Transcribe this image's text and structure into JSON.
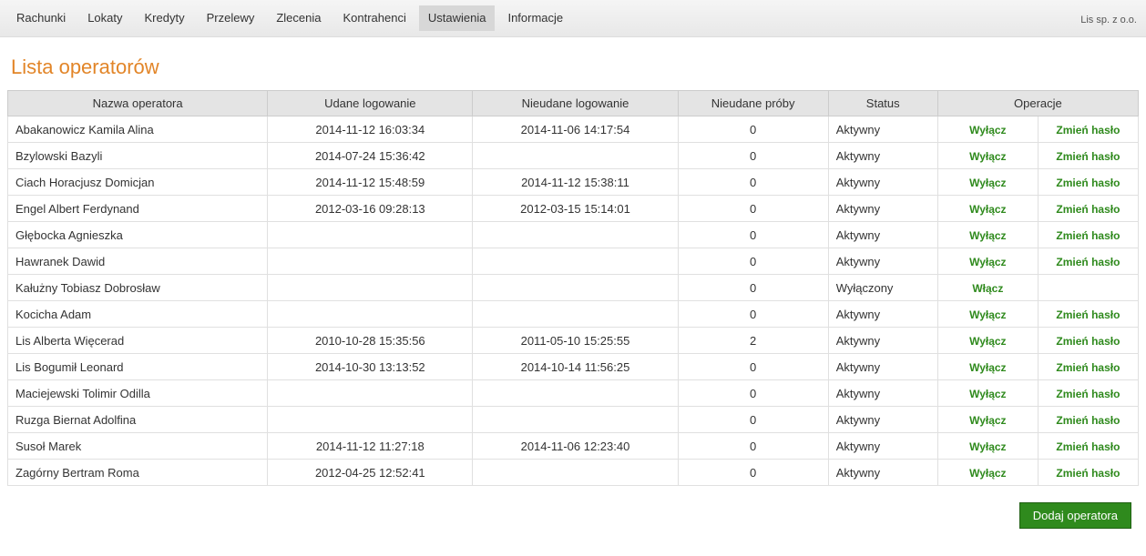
{
  "company": "Lis sp. z o.o.",
  "nav": {
    "rachunki": "Rachunki",
    "lokaty": "Lokaty",
    "kredyty": "Kredyty",
    "przelewy": "Przelewy",
    "zlecenia": "Zlecenia",
    "kontrahenci": "Kontrahenci",
    "ustawienia": "Ustawienia",
    "informacje": "Informacje"
  },
  "title": "Lista operatorów",
  "headers": {
    "name": "Nazwa operatora",
    "success": "Udane logowanie",
    "fail": "Nieudane logowanie",
    "attempts": "Nieudane próby",
    "status": "Status",
    "ops": "Operacje"
  },
  "labels": {
    "disable": "Wyłącz",
    "enable": "Włącz",
    "chpass": "Zmień hasło",
    "add": "Dodaj operatora"
  },
  "rows": [
    {
      "name": "Abakanowicz Kamila Alina",
      "success": "2014-11-12 16:03:34",
      "fail": "2014-11-06 14:17:54",
      "attempts": "0",
      "status": "Aktywny",
      "toggle": "disable",
      "chpass": true
    },
    {
      "name": "Bzylowski Bazyli",
      "success": "2014-07-24 15:36:42",
      "fail": "",
      "attempts": "0",
      "status": "Aktywny",
      "toggle": "disable",
      "chpass": true
    },
    {
      "name": "Ciach Horacjusz Domicjan",
      "success": "2014-11-12 15:48:59",
      "fail": "2014-11-12 15:38:11",
      "attempts": "0",
      "status": "Aktywny",
      "toggle": "disable",
      "chpass": true
    },
    {
      "name": "Engel Albert Ferdynand",
      "success": "2012-03-16 09:28:13",
      "fail": "2012-03-15 15:14:01",
      "attempts": "0",
      "status": "Aktywny",
      "toggle": "disable",
      "chpass": true
    },
    {
      "name": "Głębocka Agnieszka",
      "success": "",
      "fail": "",
      "attempts": "0",
      "status": "Aktywny",
      "toggle": "disable",
      "chpass": true
    },
    {
      "name": "Hawranek Dawid",
      "success": "",
      "fail": "",
      "attempts": "0",
      "status": "Aktywny",
      "toggle": "disable",
      "chpass": true
    },
    {
      "name": "Kałużny Tobiasz Dobrosław",
      "success": "",
      "fail": "",
      "attempts": "0",
      "status": "Wyłączony",
      "toggle": "enable",
      "chpass": false
    },
    {
      "name": "Kocicha Adam",
      "success": "",
      "fail": "",
      "attempts": "0",
      "status": "Aktywny",
      "toggle": "disable",
      "chpass": true
    },
    {
      "name": "Lis Alberta Więcerad",
      "success": "2010-10-28 15:35:56",
      "fail": "2011-05-10 15:25:55",
      "attempts": "2",
      "status": "Aktywny",
      "toggle": "disable",
      "chpass": true
    },
    {
      "name": "Lis Bogumił Leonard",
      "success": "2014-10-30 13:13:52",
      "fail": "2014-10-14 11:56:25",
      "attempts": "0",
      "status": "Aktywny",
      "toggle": "disable",
      "chpass": true
    },
    {
      "name": "Maciejewski Tolimir Odilla",
      "success": "",
      "fail": "",
      "attempts": "0",
      "status": "Aktywny",
      "toggle": "disable",
      "chpass": true
    },
    {
      "name": "Ruzga Biernat Adolfina",
      "success": "",
      "fail": "",
      "attempts": "0",
      "status": "Aktywny",
      "toggle": "disable",
      "chpass": true
    },
    {
      "name": "Susoł Marek",
      "success": "2014-11-12 11:27:18",
      "fail": "2014-11-06 12:23:40",
      "attempts": "0",
      "status": "Aktywny",
      "toggle": "disable",
      "chpass": true
    },
    {
      "name": "Zagórny Bertram Roma",
      "success": "2012-04-25 12:52:41",
      "fail": "",
      "attempts": "0",
      "status": "Aktywny",
      "toggle": "disable",
      "chpass": true
    }
  ]
}
